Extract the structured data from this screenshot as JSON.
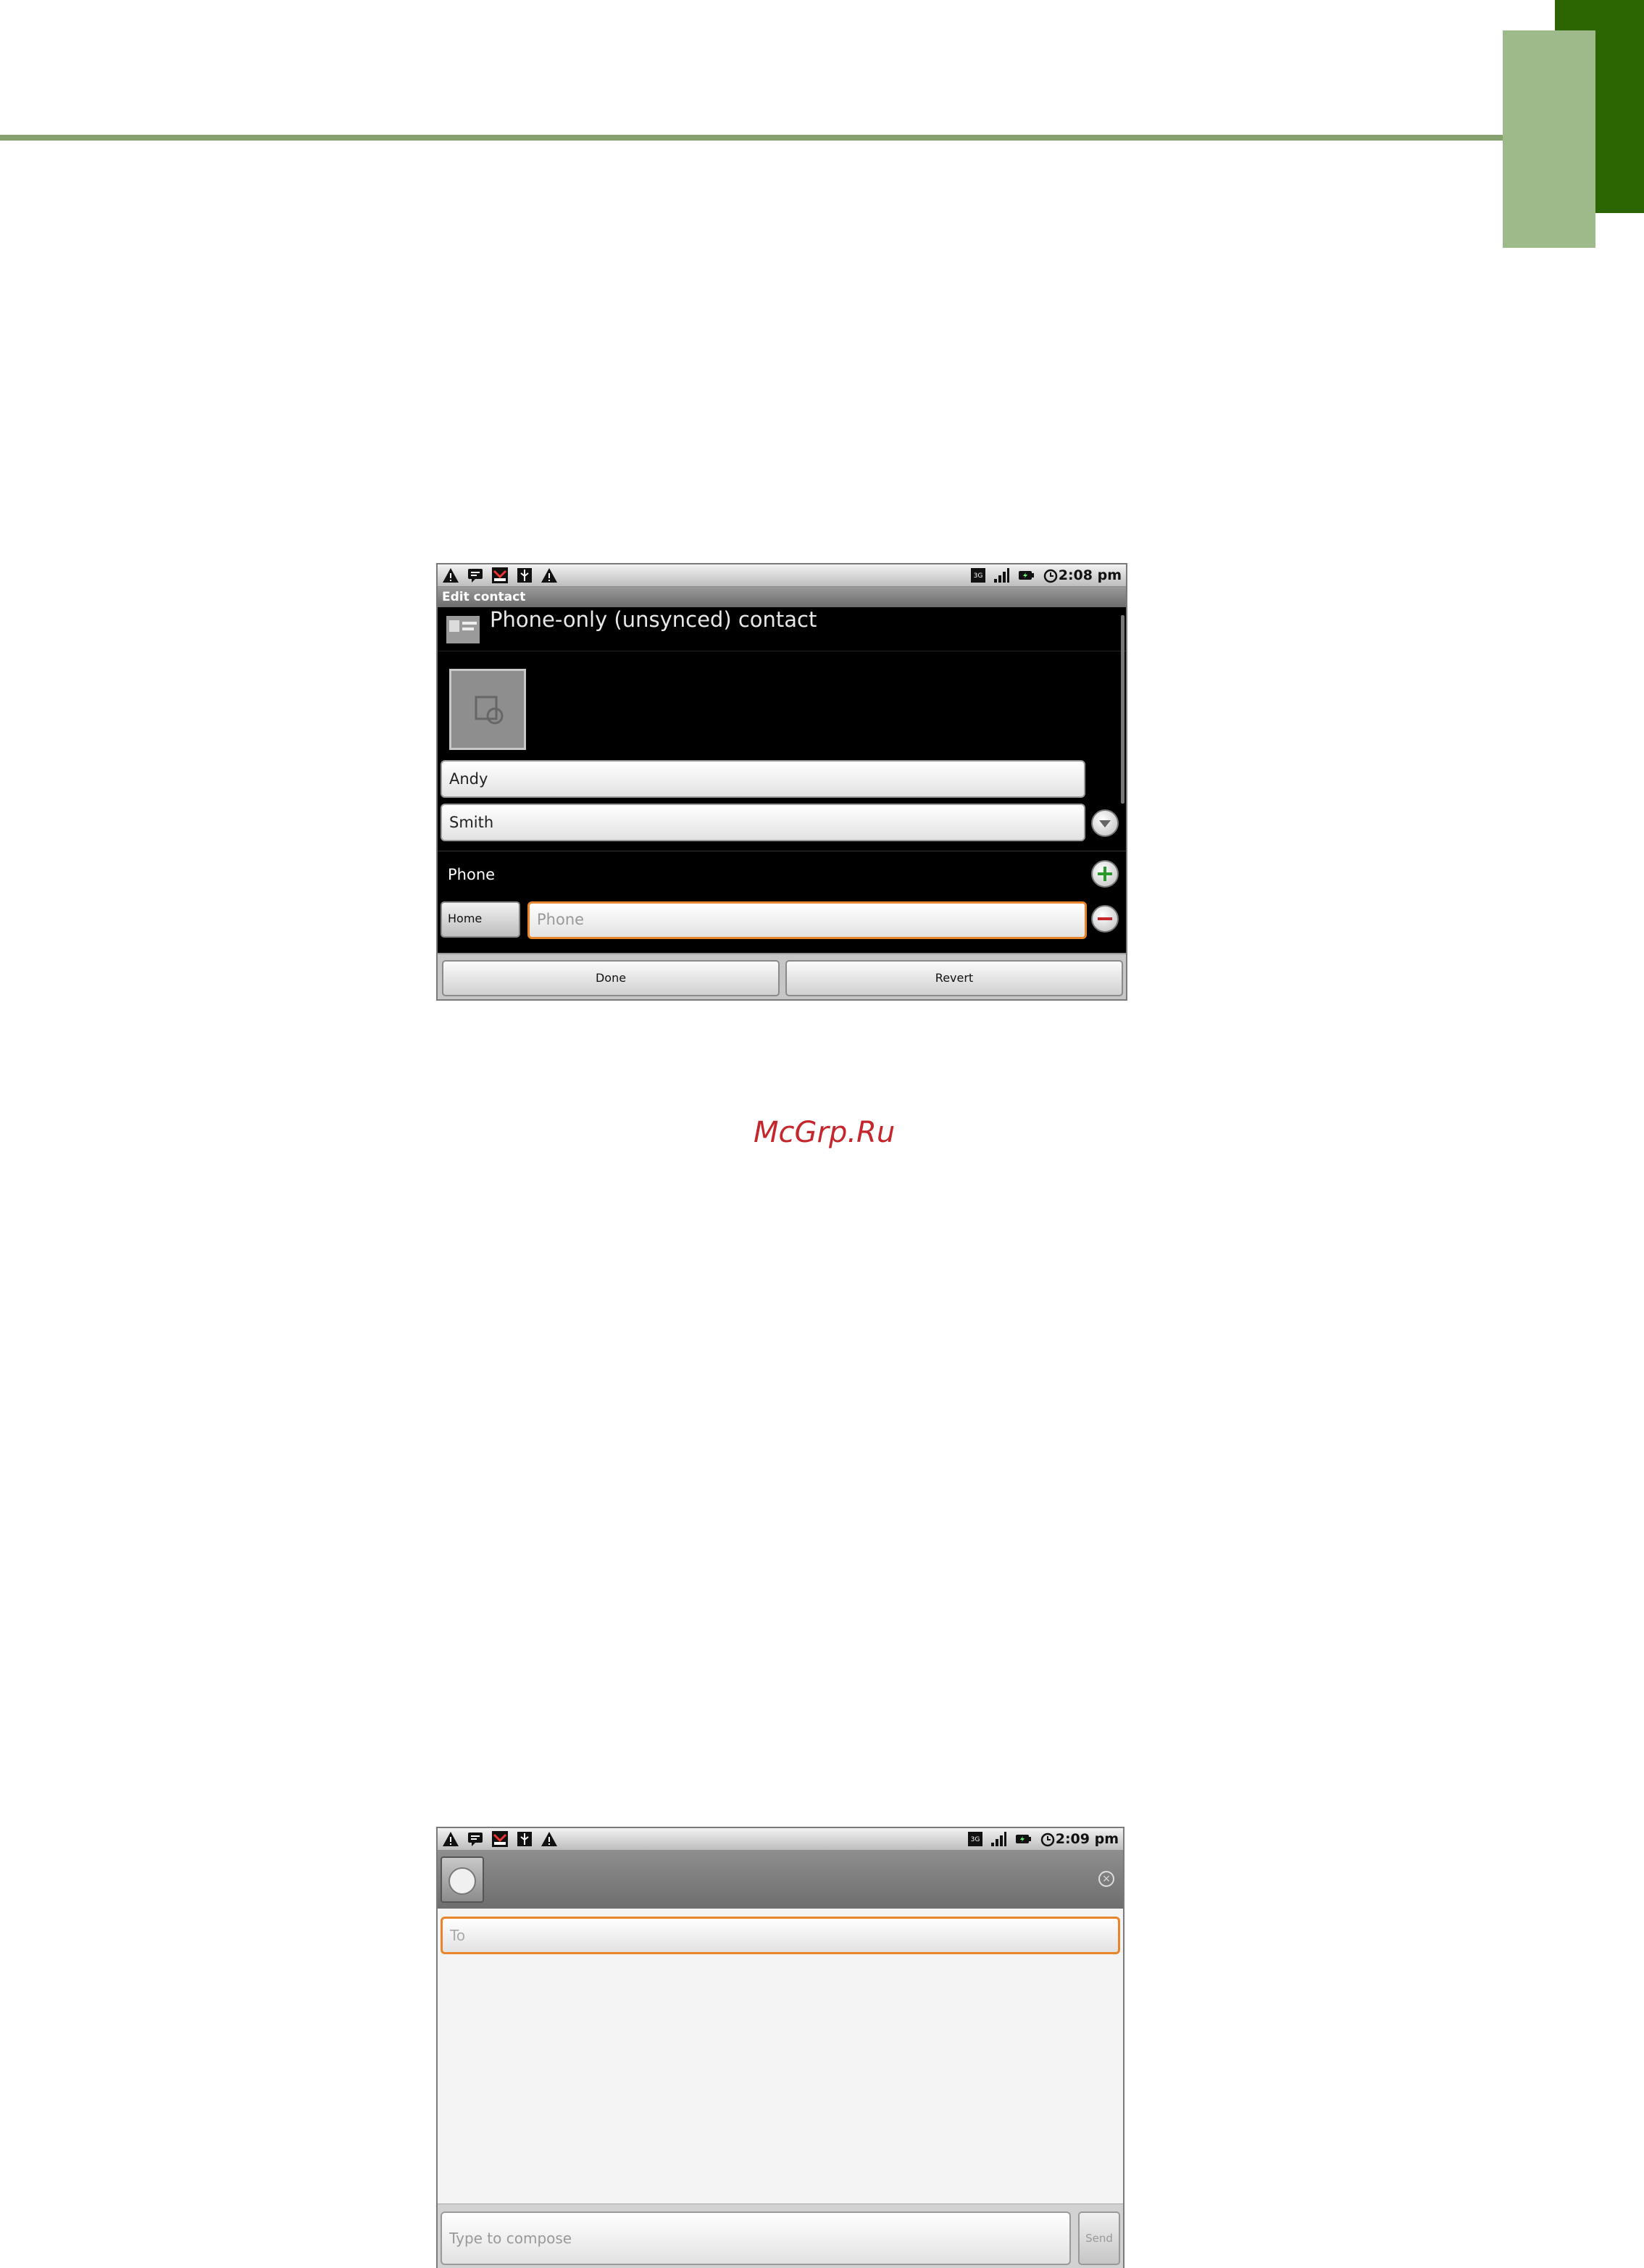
{
  "page": {
    "watermark": "McGrp.Ru"
  },
  "edit_contact_screen": {
    "status_bar": {
      "time": "2:08 pm",
      "left_icons": [
        "warning-icon",
        "chat-icon",
        "missed-call-icon",
        "usb-icon",
        "warning-icon"
      ],
      "right_icons": [
        "3g-icon",
        "signal-icon",
        "battery-icon",
        "alarm-icon"
      ]
    },
    "title": "Edit contact",
    "account_label": "Phone-only (unsynced) contact",
    "first_name": "Andy",
    "last_name": "Smith",
    "phone_section_label": "Phone",
    "phone_type": "Home",
    "phone_placeholder": "Phone",
    "done_label": "Done",
    "revert_label": "Revert"
  },
  "messaging_screen": {
    "status_bar": {
      "time": "2:09 pm",
      "left_icons": [
        "warning-icon",
        "chat-icon",
        "missed-call-icon",
        "usb-icon",
        "warning-icon"
      ],
      "right_icons": [
        "3g-icon",
        "signal-icon",
        "battery-icon",
        "alarm-icon"
      ]
    },
    "to_placeholder": "To",
    "compose_placeholder": "Type to compose",
    "send_label": "Send"
  },
  "colors": {
    "accent_green_dark": "#2b6603",
    "accent_green_light": "#9eba8a",
    "rule_green": "#87a070",
    "focus_orange": "#e8842a",
    "watermark_red": "#c4262c"
  }
}
